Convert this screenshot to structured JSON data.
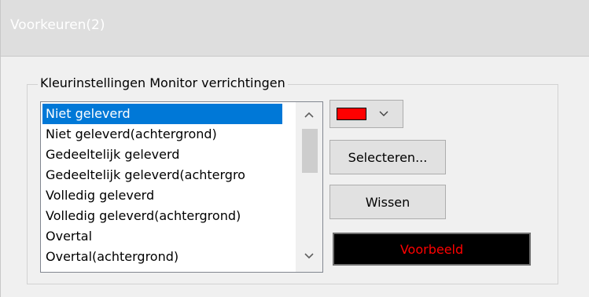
{
  "window": {
    "title": "Voorkeuren(2)"
  },
  "group": {
    "label": "Kleurinstellingen Monitor verrichtingen"
  },
  "list": {
    "selected_index": 0,
    "items": [
      "Niet geleverd",
      "Niet geleverd(achtergrond)",
      "Gedeeltelijk geleverd",
      "Gedeeltelijk geleverd(achtergro",
      "Volledig geleverd",
      "Volledig geleverd(achtergrond)",
      "Overtal",
      "Overtal(achtergrond)"
    ]
  },
  "color_picker": {
    "selected_color": "#ff0000"
  },
  "buttons": {
    "select_label": "Selecteren...",
    "clear_label": "Wissen"
  },
  "preview": {
    "label": "Voorbeeld",
    "text_color": "#ff0000",
    "background": "#000000"
  },
  "icons": {
    "scroll_up": "chevron-up-icon",
    "scroll_down": "chevron-down-icon",
    "dropdown": "chevron-down-icon"
  }
}
